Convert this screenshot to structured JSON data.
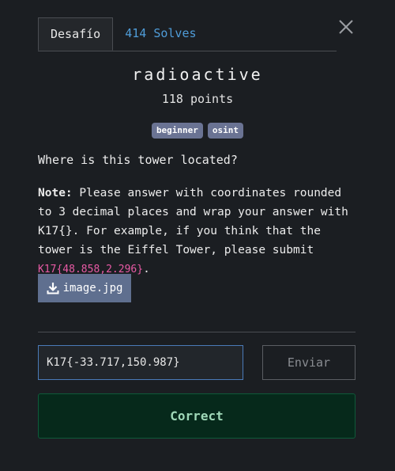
{
  "tabs": {
    "challenge_label": "Desafío",
    "solves_label": "414 Solves"
  },
  "challenge": {
    "name": "radioactive",
    "points": "118 points",
    "tags": [
      "beginner",
      "osint"
    ],
    "question": "Where is this tower located?",
    "note_label": "Note:",
    "note_text": " Please answer with coordinates rounded to 3 decimal places and wrap your answer with K17{}. For example, if you think that the tower is the Eiffel Tower, please submit ",
    "note_example": "K17{48.858,2.296}",
    "note_end": "."
  },
  "attachment": {
    "filename": "image.jpg",
    "icon": "download-icon"
  },
  "form": {
    "answer_value": "K17{-33.717,150.987}",
    "submit_label": "Enviar"
  },
  "result": {
    "message": "Correct"
  },
  "colors": {
    "background": "#1b1e22",
    "tab_link": "#4f9cd8",
    "tag_bg": "#6a7393",
    "code": "#e85aa5",
    "download_bg": "#5f6f8f",
    "input_border": "#4a7ab8",
    "success_bg": "#06291b",
    "success_text": "#9fd8b8"
  }
}
